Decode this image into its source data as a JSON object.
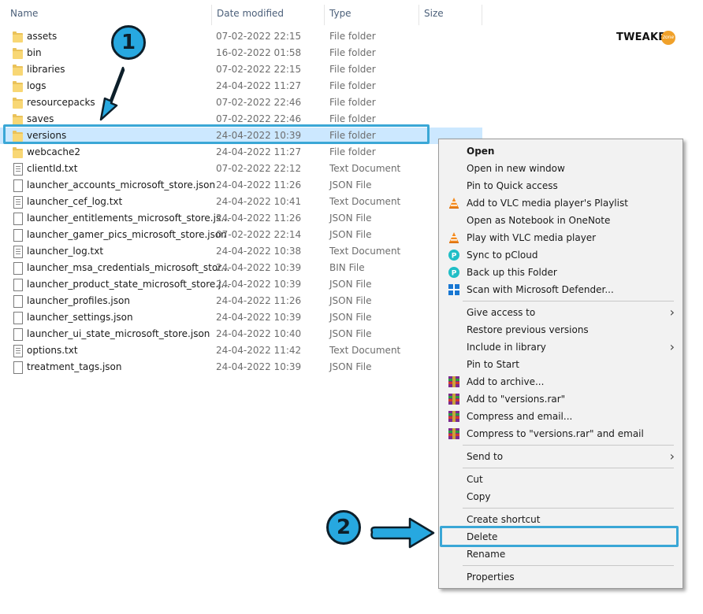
{
  "columns": {
    "name": "Name",
    "date": "Date modified",
    "type": "Type",
    "size": "Size"
  },
  "files": [
    {
      "name": "assets",
      "date": "07-02-2022 22:15",
      "type": "File folder",
      "icon": "folder"
    },
    {
      "name": "bin",
      "date": "16-02-2022 01:58",
      "type": "File folder",
      "icon": "folder"
    },
    {
      "name": "libraries",
      "date": "07-02-2022 22:15",
      "type": "File folder",
      "icon": "folder"
    },
    {
      "name": "logs",
      "date": "24-04-2022 11:27",
      "type": "File folder",
      "icon": "folder"
    },
    {
      "name": "resourcepacks",
      "date": "07-02-2022 22:46",
      "type": "File folder",
      "icon": "folder"
    },
    {
      "name": "saves",
      "date": "07-02-2022 22:46",
      "type": "File folder",
      "icon": "folder"
    },
    {
      "name": "versions",
      "date": "24-04-2022 10:39",
      "type": "File folder",
      "icon": "folder",
      "selected": true
    },
    {
      "name": "webcache2",
      "date": "24-04-2022 11:27",
      "type": "File folder",
      "icon": "folder"
    },
    {
      "name": "clientId.txt",
      "date": "07-02-2022 22:12",
      "type": "Text Document",
      "icon": "text"
    },
    {
      "name": "launcher_accounts_microsoft_store.json",
      "date": "24-04-2022 11:26",
      "type": "JSON File",
      "icon": "file"
    },
    {
      "name": "launcher_cef_log.txt",
      "date": "24-04-2022 10:41",
      "type": "Text Document",
      "icon": "text"
    },
    {
      "name": "launcher_entitlements_microsoft_store.js...",
      "date": "24-04-2022 11:26",
      "type": "JSON File",
      "icon": "file"
    },
    {
      "name": "launcher_gamer_pics_microsoft_store.json",
      "date": "07-02-2022 22:14",
      "type": "JSON File",
      "icon": "file"
    },
    {
      "name": "launcher_log.txt",
      "date": "24-04-2022 10:38",
      "type": "Text Document",
      "icon": "text"
    },
    {
      "name": "launcher_msa_credentials_microsoft_stor...",
      "date": "24-04-2022 10:39",
      "type": "BIN File",
      "icon": "file"
    },
    {
      "name": "launcher_product_state_microsoft_store.j...",
      "date": "24-04-2022 10:39",
      "type": "JSON File",
      "icon": "file"
    },
    {
      "name": "launcher_profiles.json",
      "date": "24-04-2022 11:26",
      "type": "JSON File",
      "icon": "file"
    },
    {
      "name": "launcher_settings.json",
      "date": "24-04-2022 10:39",
      "type": "JSON File",
      "icon": "file"
    },
    {
      "name": "launcher_ui_state_microsoft_store.json",
      "date": "24-04-2022 10:40",
      "type": "JSON File",
      "icon": "file"
    },
    {
      "name": "options.txt",
      "date": "24-04-2022 11:42",
      "type": "Text Document",
      "icon": "text"
    },
    {
      "name": "treatment_tags.json",
      "date": "24-04-2022 10:39",
      "type": "JSON File",
      "icon": "file"
    }
  ],
  "context_menu": {
    "groups": [
      [
        {
          "label": "Open",
          "bold": true
        },
        {
          "label": "Open in new window"
        },
        {
          "label": "Pin to Quick access"
        },
        {
          "label": "Add to VLC media player's Playlist",
          "icon": "vlc"
        },
        {
          "label": "Open as Notebook in OneNote"
        },
        {
          "label": "Play with VLC media player",
          "icon": "vlc"
        },
        {
          "label": "Sync to pCloud",
          "icon": "pcloud"
        },
        {
          "label": "Back up this Folder",
          "icon": "pcloud"
        },
        {
          "label": "Scan with Microsoft Defender...",
          "icon": "defender"
        }
      ],
      [
        {
          "label": "Give access to",
          "submenu": true
        },
        {
          "label": "Restore previous versions"
        },
        {
          "label": "Include in library",
          "submenu": true
        },
        {
          "label": "Pin to Start"
        },
        {
          "label": "Add to archive...",
          "icon": "winrar"
        },
        {
          "label": "Add to \"versions.rar\"",
          "icon": "winrar"
        },
        {
          "label": "Compress and email...",
          "icon": "winrar"
        },
        {
          "label": "Compress to \"versions.rar\" and email",
          "icon": "winrar"
        }
      ],
      [
        {
          "label": "Send to",
          "submenu": true
        }
      ],
      [
        {
          "label": "Cut"
        },
        {
          "label": "Copy"
        }
      ],
      [
        {
          "label": "Create shortcut"
        },
        {
          "label": "Delete",
          "highlighted": true
        },
        {
          "label": "Rename"
        }
      ],
      [
        {
          "label": "Properties"
        }
      ]
    ]
  },
  "annotations": {
    "step1": "1",
    "step2": "2"
  },
  "logo": {
    "text": "TWEAKER",
    "badge": "zone"
  },
  "colors": {
    "highlight": "#3aa7d6",
    "selection": "#cce8ff",
    "badge": "#27a8e0"
  }
}
